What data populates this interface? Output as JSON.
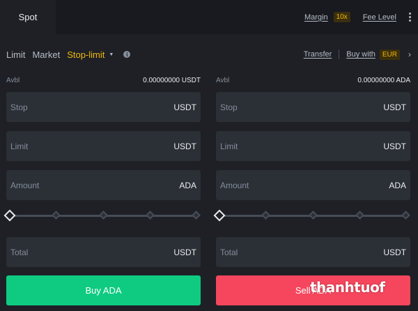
{
  "header": {
    "tab_spot": "Spot",
    "margin_label": "Margin",
    "leverage": "10x",
    "fee_level": "Fee Level"
  },
  "order_types": {
    "limit": "Limit",
    "market": "Market",
    "stop_limit": "Stop-limit",
    "active": "stop_limit"
  },
  "actions": {
    "transfer": "Transfer",
    "buy_with": "Buy with",
    "currency": "EUR"
  },
  "buy": {
    "avbl_label": "Avbl",
    "avbl_value": "0.00000000 USDT",
    "stop_label": "Stop",
    "stop_unit": "USDT",
    "limit_label": "Limit",
    "limit_unit": "USDT",
    "amount_label": "Amount",
    "amount_unit": "ADA",
    "total_label": "Total",
    "total_unit": "USDT",
    "button": "Buy ADA",
    "slider_percent": 0
  },
  "sell": {
    "avbl_label": "Avbl",
    "avbl_value": "0.00000000 ADA",
    "stop_label": "Stop",
    "stop_unit": "USDT",
    "limit_label": "Limit",
    "limit_unit": "USDT",
    "amount_label": "Amount",
    "amount_unit": "ADA",
    "total_label": "Total",
    "total_unit": "USDT",
    "button": "Sell ADA",
    "slider_percent": 0
  },
  "watermark": "thanhtuof",
  "colors": {
    "accent": "#f0b90b",
    "buy": "#0ecb81",
    "sell": "#f6465d",
    "background": "#1e2026",
    "input": "#2b2f36"
  }
}
